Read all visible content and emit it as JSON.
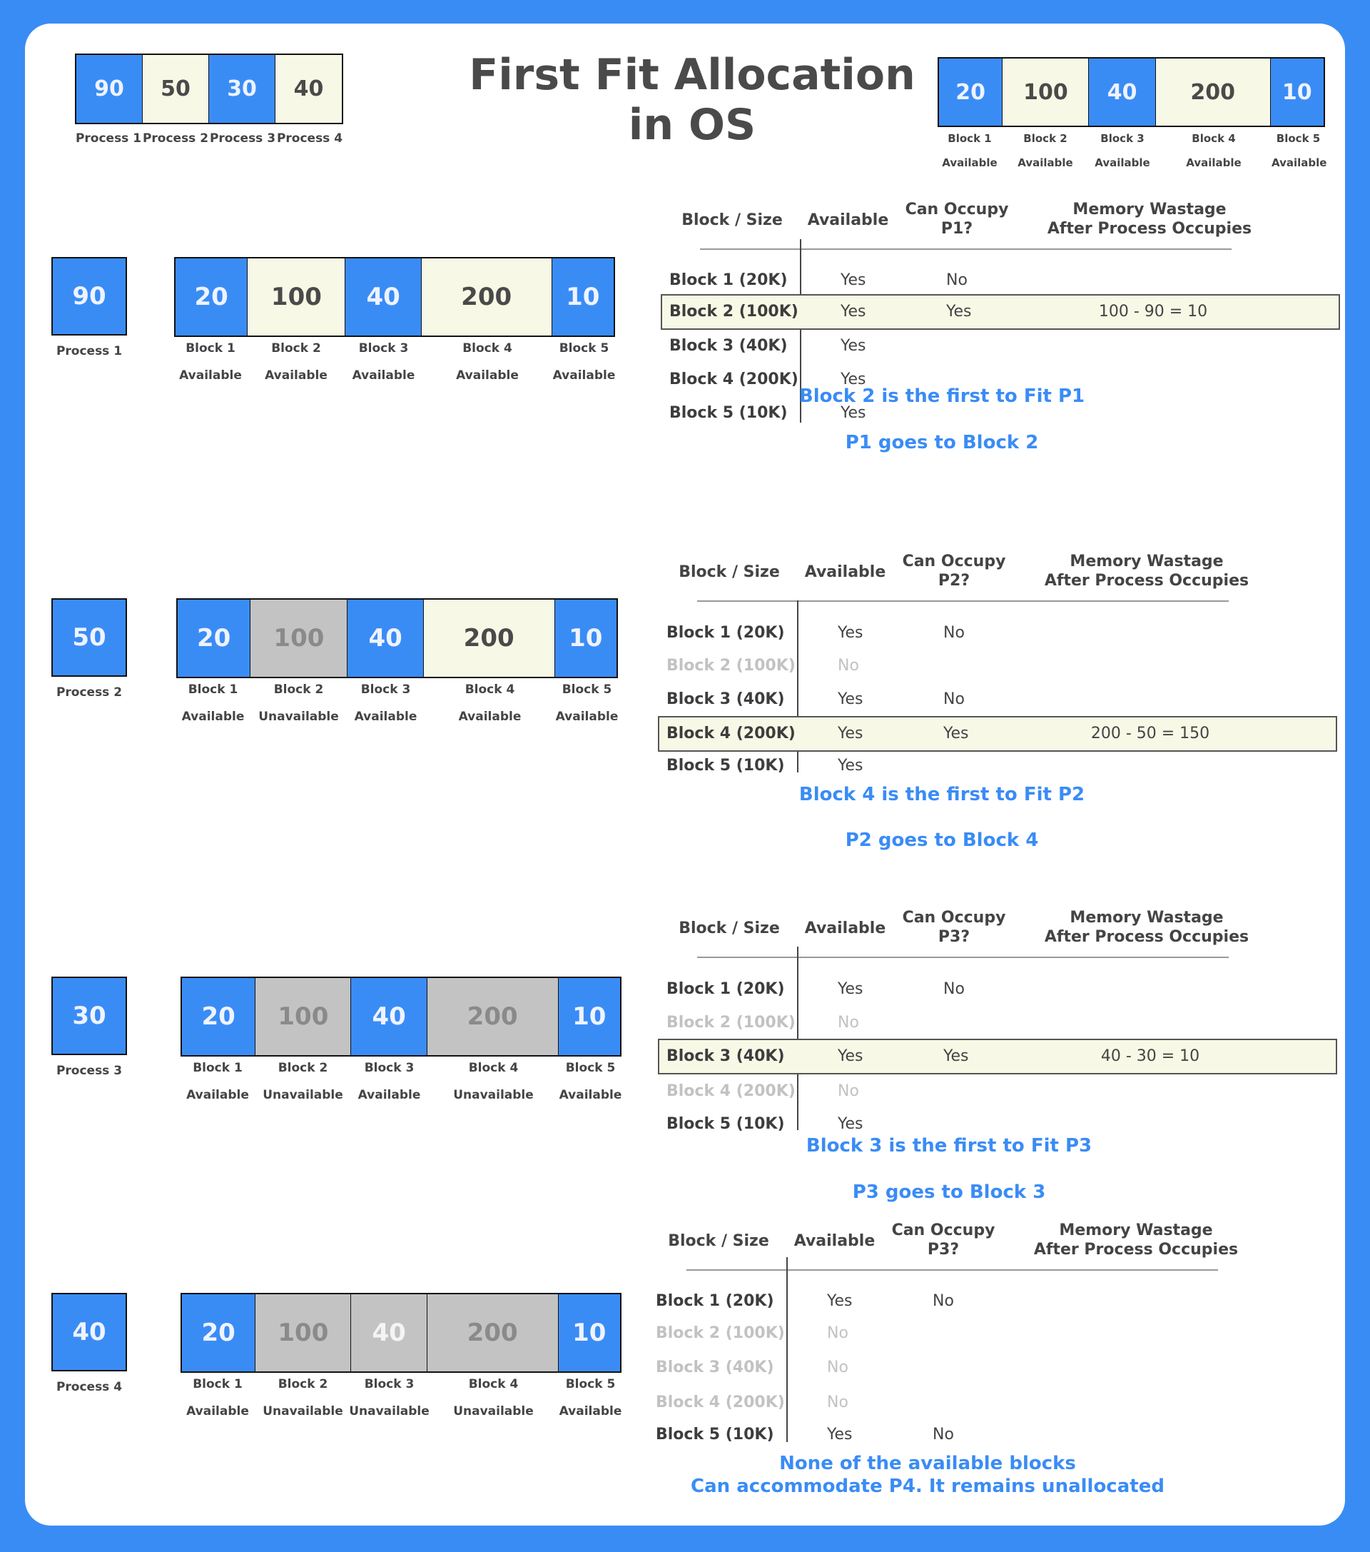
{
  "title": {
    "line1": "First Fit Allocation",
    "line2": "in OS"
  },
  "colors": {
    "background": "#3a8cf5",
    "available_blue": "#3a8cf5",
    "available_cream": "#f8f8e6",
    "unavailable_gray": "#c3c3c3",
    "note_text": "#3a8cf5"
  },
  "processes": [
    {
      "size": "90",
      "label": "Process 1"
    },
    {
      "size": "50",
      "label": "Process 2"
    },
    {
      "size": "30",
      "label": "Process 3"
    },
    {
      "size": "40",
      "label": "Process 4"
    }
  ],
  "blocks": [
    {
      "size": "20",
      "label": "Block 1",
      "status": "Available"
    },
    {
      "size": "100",
      "label": "Block 2",
      "status": "Available"
    },
    {
      "size": "40",
      "label": "Block 3",
      "status": "Available"
    },
    {
      "size": "200",
      "label": "Block 4",
      "status": "Available"
    },
    {
      "size": "10",
      "label": "Block 5",
      "status": "Available"
    }
  ],
  "steps": [
    {
      "process": {
        "size": "90",
        "label": "Process 1"
      },
      "blocks": [
        {
          "size": "20",
          "label": "Block 1",
          "status": "Available"
        },
        {
          "size": "100",
          "label": "Block 2",
          "status": "Available"
        },
        {
          "size": "40",
          "label": "Block 3",
          "status": "Available"
        },
        {
          "size": "200",
          "label": "Block 4",
          "status": "Available"
        },
        {
          "size": "10",
          "label": "Block 5",
          "status": "Available"
        }
      ],
      "table": {
        "headers": [
          "Block / Size",
          "Available",
          "Can Occupy P1?",
          "Memory Wastage After Process Occupies"
        ],
        "header_can_1": "Can Occupy",
        "header_can_2": "P1?",
        "header_mem_1": "Memory Wastage",
        "header_mem_2": "After Process Occupies",
        "rows": [
          {
            "block": "Block 1 (20K)",
            "available": "Yes",
            "can": "No",
            "waste": ""
          },
          {
            "block": "Block 2 (100K)",
            "available": "Yes",
            "can": "Yes",
            "waste": "100 - 90 = 10"
          },
          {
            "block": "Block 3 (40K)",
            "available": "Yes",
            "can": "",
            "waste": ""
          },
          {
            "block": "Block 4 (200K)",
            "available": "Yes",
            "can": "",
            "waste": ""
          },
          {
            "block": "Block 5 (10K)",
            "available": "Yes",
            "can": "",
            "waste": ""
          }
        ]
      },
      "note1": "Block 2 is the first to Fit P1",
      "note2": "P1 goes to Block 2"
    },
    {
      "process": {
        "size": "50",
        "label": "Process 2"
      },
      "blocks": [
        {
          "size": "20",
          "label": "Block 1",
          "status": "Available"
        },
        {
          "size": "100",
          "label": "Block 2",
          "status": "Unavailable"
        },
        {
          "size": "40",
          "label": "Block 3",
          "status": "Available"
        },
        {
          "size": "200",
          "label": "Block 4",
          "status": "Available"
        },
        {
          "size": "10",
          "label": "Block 5",
          "status": "Available"
        }
      ],
      "table": {
        "header_can_1": "Can Occupy",
        "header_can_2": "P2?",
        "header_mem_1": "Memory Wastage",
        "header_mem_2": "After Process Occupies",
        "rows": [
          {
            "block": "Block 1 (20K)",
            "available": "Yes",
            "can": "No",
            "waste": ""
          },
          {
            "block": "Block 2 (100K)",
            "available": "No",
            "can": "",
            "waste": ""
          },
          {
            "block": "Block 3 (40K)",
            "available": "Yes",
            "can": "No",
            "waste": ""
          },
          {
            "block": "Block 4 (200K)",
            "available": "Yes",
            "can": "Yes",
            "waste": "200 - 50 = 150"
          },
          {
            "block": "Block 5 (10K)",
            "available": "Yes",
            "can": "",
            "waste": ""
          }
        ]
      },
      "note1": "Block 4 is the first to Fit P2",
      "note2": "P2 goes to Block 4"
    },
    {
      "process": {
        "size": "30",
        "label": "Process 3"
      },
      "blocks": [
        {
          "size": "20",
          "label": "Block 1",
          "status": "Available"
        },
        {
          "size": "100",
          "label": "Block 2",
          "status": "Unavailable"
        },
        {
          "size": "40",
          "label": "Block 3",
          "status": "Available"
        },
        {
          "size": "200",
          "label": "Block 4",
          "status": "Unavailable"
        },
        {
          "size": "10",
          "label": "Block 5",
          "status": "Available"
        }
      ],
      "table": {
        "header_can_1": "Can Occupy",
        "header_can_2": "P3?",
        "header_mem_1": "Memory Wastage",
        "header_mem_2": "After Process Occupies",
        "rows": [
          {
            "block": "Block 1 (20K)",
            "available": "Yes",
            "can": "No",
            "waste": ""
          },
          {
            "block": "Block 2 (100K)",
            "available": "No",
            "can": "",
            "waste": ""
          },
          {
            "block": "Block 3 (40K)",
            "available": "Yes",
            "can": "Yes",
            "waste": "40 - 30 = 10"
          },
          {
            "block": "Block 4 (200K)",
            "available": "No",
            "can": "",
            "waste": ""
          },
          {
            "block": "Block 5 (10K)",
            "available": "Yes",
            "can": "",
            "waste": ""
          }
        ]
      },
      "note1": "Block 3 is the first to Fit P3",
      "note2": "P3 goes to Block 3"
    },
    {
      "process": {
        "size": "40",
        "label": "Process 4"
      },
      "blocks": [
        {
          "size": "20",
          "label": "Block 1",
          "status": "Available"
        },
        {
          "size": "100",
          "label": "Block 2",
          "status": "Unavailable"
        },
        {
          "size": "40",
          "label": "Block 3",
          "status": "Unavailable"
        },
        {
          "size": "200",
          "label": "Block 4",
          "status": "Unavailable"
        },
        {
          "size": "10",
          "label": "Block 5",
          "status": "Available"
        }
      ],
      "table": {
        "header_can_1": "Can Occupy",
        "header_can_2": "P3?",
        "header_mem_1": "Memory Wastage",
        "header_mem_2": "After Process Occupies",
        "rows": [
          {
            "block": "Block 1 (20K)",
            "available": "Yes",
            "can": "No",
            "waste": ""
          },
          {
            "block": "Block 2 (100K)",
            "available": "No",
            "can": "",
            "waste": ""
          },
          {
            "block": "Block 3 (40K)",
            "available": "No",
            "can": "",
            "waste": ""
          },
          {
            "block": "Block 4 (200K)",
            "available": "No",
            "can": "",
            "waste": ""
          },
          {
            "block": "Block 5 (10K)",
            "available": "Yes",
            "can": "No",
            "waste": ""
          }
        ]
      },
      "note1": "None of the available blocks",
      "note2": "Can accommodate P4. It remains unallocated"
    }
  ],
  "table_header_block": "Block / Size",
  "table_header_available": "Available"
}
